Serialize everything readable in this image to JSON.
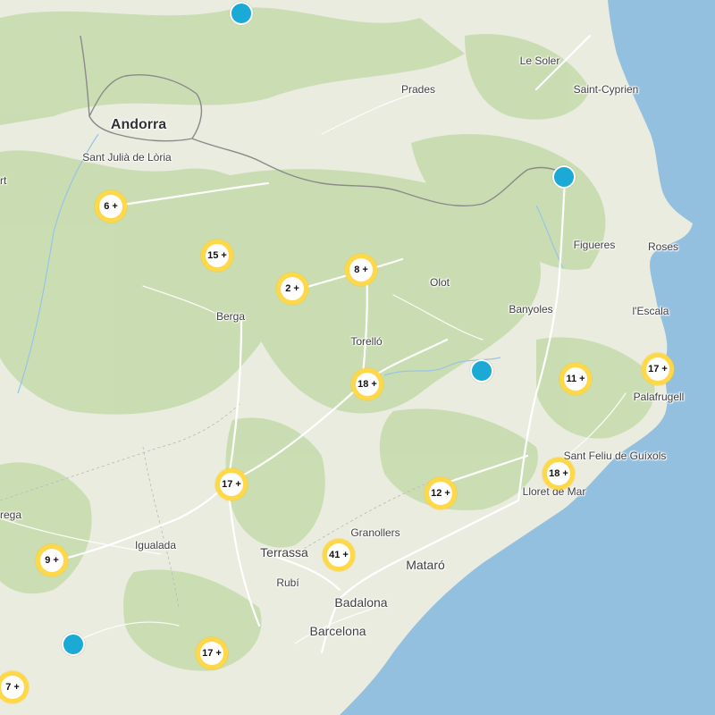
{
  "map": {
    "colors": {
      "sea": "#94c0e0",
      "land": "#e9ecdf",
      "forest": "#c9ddb0",
      "road": "#ffffff",
      "border": "#8a8a8a",
      "cluster_ring": "#ffd84a",
      "marker": "#1ba9d6"
    },
    "places": {
      "andorra": "Andorra",
      "sant_julia": "Sant Julià de Lòria",
      "le_soler": "Le Soler",
      "prades": "Prades",
      "saint_cyprien": "Saint-Cyprien",
      "figueres": "Figueres",
      "roses": "Roses",
      "olot": "Olot",
      "banyoles": "Banyoles",
      "lescala": "l'Escala",
      "berga": "Berga",
      "torello": "Torelló",
      "palafrugell": "Palafrugell",
      "sant_feliu": "Sant Feliu de Guíxols",
      "lloret": "Lloret de Mar",
      "igualada": "Igualada",
      "granollers": "Granollers",
      "terrassa": "Terrassa",
      "mataro": "Mataró",
      "rubi": "Rubí",
      "badalona": "Badalona",
      "barcelona": "Barcelona",
      "edge_rt": "rt",
      "edge_rega": "rega"
    },
    "clusters": [
      {
        "label": "6 +"
      },
      {
        "label": "15 +"
      },
      {
        "label": "2 +"
      },
      {
        "label": "8 +"
      },
      {
        "label": "18 +"
      },
      {
        "label": "11 +"
      },
      {
        "label": "17 +"
      },
      {
        "label": "17 +"
      },
      {
        "label": "18 +"
      },
      {
        "label": "12 +"
      },
      {
        "label": "9 +"
      },
      {
        "label": "41 +"
      },
      {
        "label": "17 +"
      },
      {
        "label": "7 +"
      }
    ],
    "markers_icon": "location-pin-icon"
  }
}
